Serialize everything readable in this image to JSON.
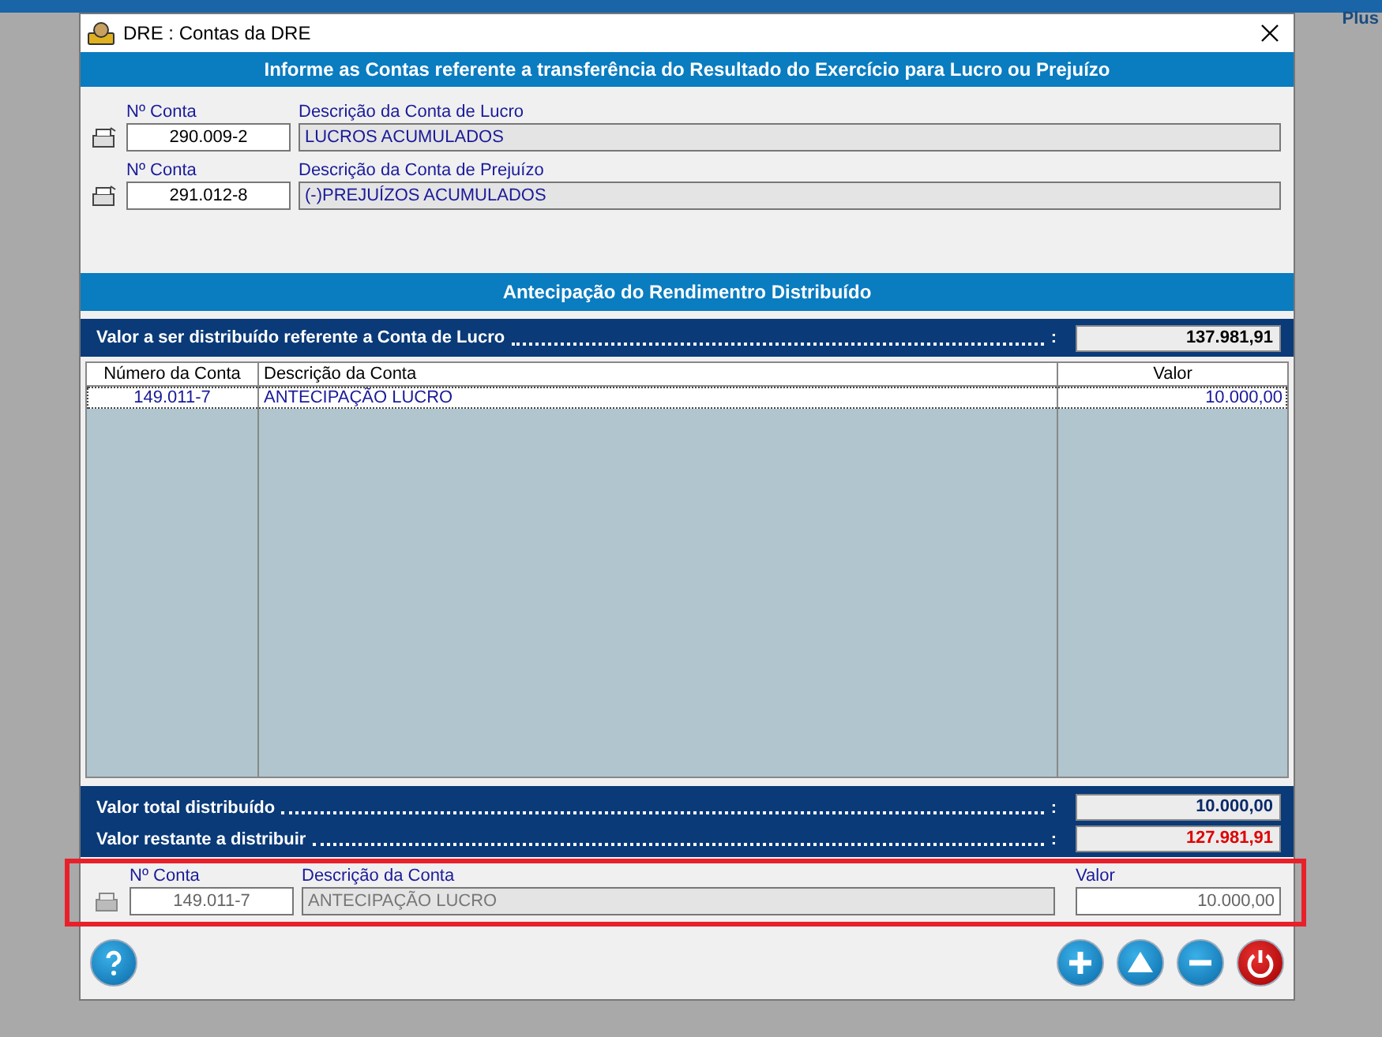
{
  "background": {
    "corner_text": "Plus"
  },
  "window": {
    "title": "DRE : Contas da DRE"
  },
  "header": "Informe as Contas referente a transferência do Resultado do Exercício para Lucro ou Prejuízo",
  "accounts": [
    {
      "number_label": "Nº Conta",
      "number": "290.009-2",
      "description_label": "Descrição da Conta de Lucro",
      "description": "LUCROS ACUMULADOS"
    },
    {
      "number_label": "Nº Conta",
      "number": "291.012-8",
      "description_label": "Descrição da Conta de Prejuízo",
      "description": "(-)PREJUÍZOS ACUMULADOS"
    }
  ],
  "section_title": "Antecipação do Rendimentro Distribuído",
  "to_distribute": {
    "label": "Valor a ser distribuído referente a Conta de Lucro",
    "separator": ":",
    "value": "137.981,91"
  },
  "table": {
    "columns": [
      "Número da Conta",
      "Descrição da Conta",
      "Valor"
    ],
    "rows": [
      {
        "cells": [
          "149.011-7",
          "ANTECIPAÇÃO LUCRO",
          "10.000,00"
        ],
        "selected": true
      }
    ]
  },
  "totals": [
    {
      "label": "Valor total distribuído",
      "separator": ":",
      "value": "10.000,00",
      "kind": "normal"
    },
    {
      "label": "Valor restante a distribuir",
      "separator": ":",
      "value": "127.981,91",
      "kind": "alert"
    }
  ],
  "entry": {
    "disabled": true,
    "number_label": "Nº Conta",
    "number": "149.011-7",
    "description_label": "Descrição da Conta",
    "description": "ANTECIPAÇÃO LUCRO",
    "value_label": "Valor",
    "value": "10.000,00",
    "highlighted": true
  },
  "buttons": [
    {
      "kind": "help"
    },
    {
      "kind": "add"
    },
    {
      "kind": "up"
    },
    {
      "kind": "remove"
    },
    {
      "kind": "close"
    }
  ]
}
